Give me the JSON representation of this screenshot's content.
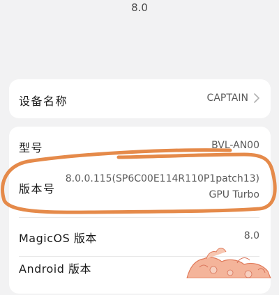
{
  "header": {
    "version": "8.0"
  },
  "device": {
    "label": "设备名称",
    "value": "CAPTAIN"
  },
  "info": {
    "model": {
      "label": "型号",
      "value": "BVL-AN00"
    },
    "build": {
      "label": "版本号",
      "value_line1": "8.0.0.115(SP6C00E114R110P1patch13)",
      "value_line2": "GPU Turbo"
    },
    "magicos": {
      "label": "MagicOS 版本",
      "value": "8.0"
    },
    "android": {
      "label": "Android 版本",
      "value": ""
    }
  },
  "colors": {
    "annotation_stroke": "#e58a4a",
    "doodle_fill": "#f0a58a",
    "background": "#f2f2f3",
    "card": "#ffffff"
  },
  "icons": {
    "chevron": "chevron-right-icon"
  }
}
